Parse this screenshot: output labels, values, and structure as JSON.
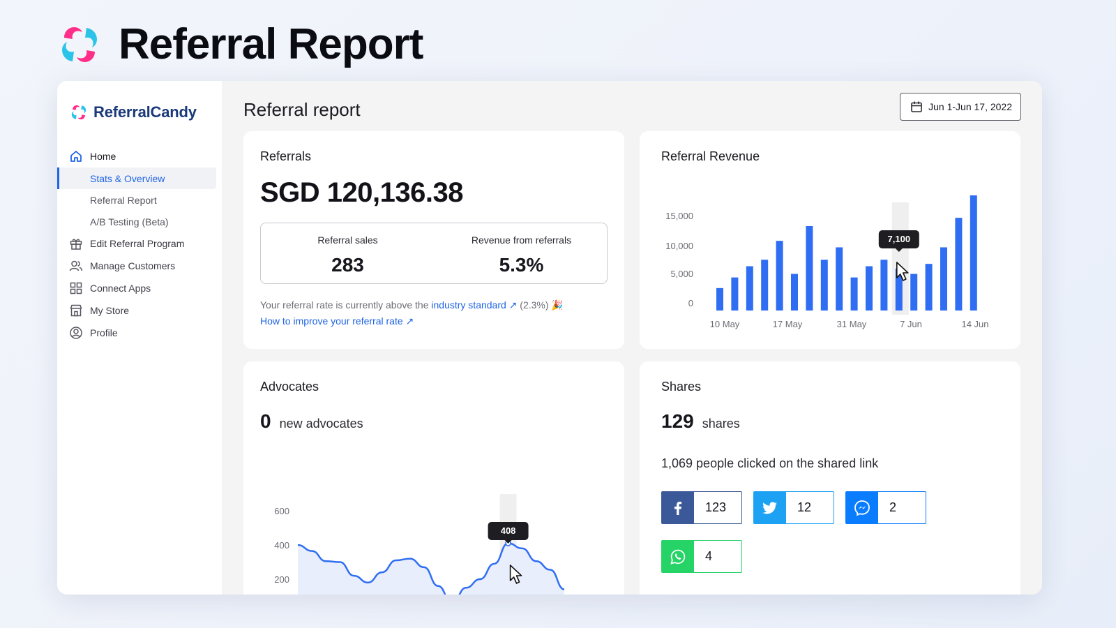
{
  "hero": {
    "title": "Referral Report"
  },
  "brand": {
    "name": "ReferralCandy"
  },
  "nav": {
    "home": "Home",
    "stats": "Stats & Overview",
    "referral_report": "Referral Report",
    "ab_testing": "A/B Testing (Beta)",
    "edit_program": "Edit Referral Program",
    "manage_customers": "Manage Customers",
    "connect_apps": "Connect Apps",
    "my_store": "My Store",
    "profile": "Profile"
  },
  "page": {
    "title": "Referral report",
    "date_range": "Jun 1-Jun 17, 2022"
  },
  "referrals": {
    "title": "Referrals",
    "amount": "SGD 120,136.38",
    "sales_label": "Referral sales",
    "sales_value": "283",
    "revenue_label": "Revenue from referrals",
    "revenue_value": "5.3%",
    "note_prefix": "Your referral rate is currently above the",
    "note_link": "industry standard ↗",
    "note_suffix": "(2.3%) 🎉",
    "improve_link": "How to improve your referral rate ↗"
  },
  "revenue": {
    "title": "Referral Revenue",
    "tooltip": "7,100"
  },
  "advocates": {
    "title": "Advocates",
    "count": "0",
    "label": "new advocates",
    "tooltip": "408"
  },
  "shares": {
    "title": "Shares",
    "count": "129",
    "label": "shares",
    "clicked": "1,069 people clicked on the shared link",
    "facebook": "123",
    "twitter": "12",
    "messenger": "2",
    "whatsapp": "4",
    "colors": {
      "facebook": "#3b5998",
      "twitter": "#1da1f2",
      "messenger": "#0a7cff",
      "whatsapp": "#25d366"
    }
  },
  "chart_data": [
    {
      "type": "bar",
      "yticks": [
        "0",
        "5,000",
        "10,000",
        "15,000"
      ],
      "ylim": [
        0,
        19500
      ],
      "xticks": [
        "10 May",
        "17 May",
        "31 May",
        "7 Jun",
        "14 Jun"
      ],
      "values": [
        3800,
        5600,
        7500,
        8600,
        11800,
        6200,
        14300,
        8600,
        10700,
        5600,
        7500,
        8600,
        7100,
        6200,
        7900,
        10700,
        15700,
        19700
      ],
      "highlight_index": 12,
      "color": "#2f6ef2"
    },
    {
      "type": "area",
      "yticks": [
        "200",
        "400",
        "600"
      ],
      "values": [
        400,
        365,
        305,
        300,
        220,
        180,
        240,
        310,
        320,
        270,
        160,
        60,
        150,
        200,
        290,
        410,
        380,
        305,
        255,
        140
      ],
      "highlight_index": 15,
      "color": "#2f6ef2"
    }
  ]
}
